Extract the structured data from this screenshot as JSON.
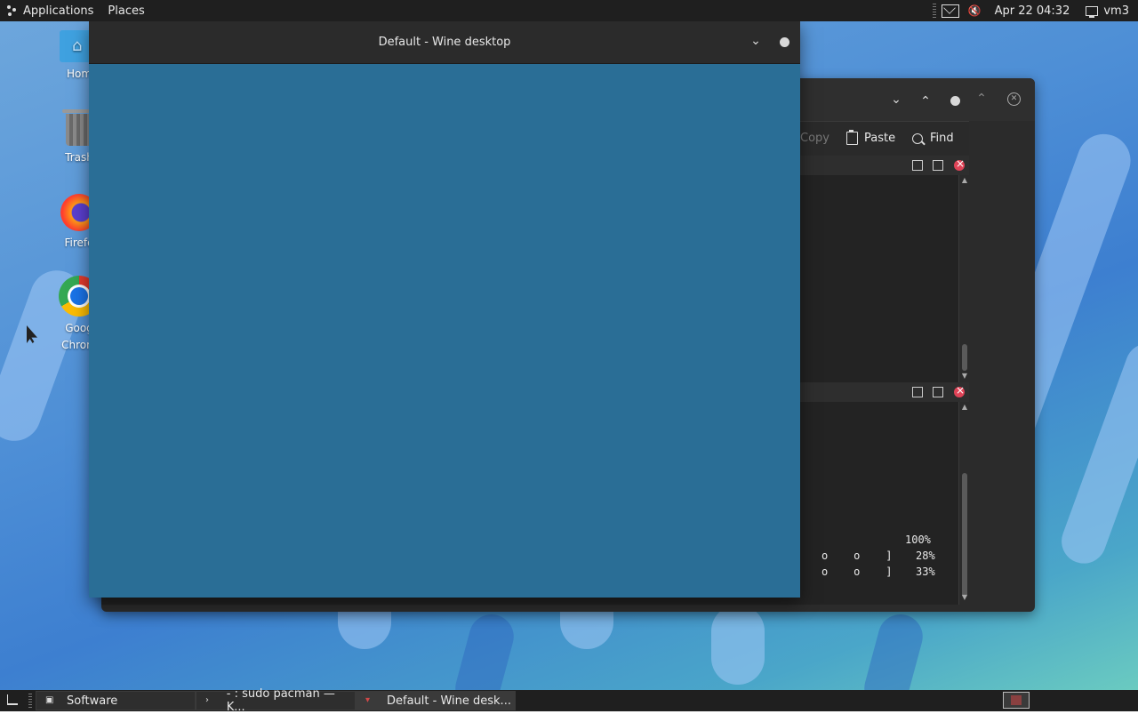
{
  "top_panel": {
    "applications_label": "Applications",
    "places_label": "Places",
    "clock": "Apr 22  04:32",
    "user": "vm3"
  },
  "desktop_icons": [
    {
      "label": "Home",
      "icon": "folder-home-icon"
    },
    {
      "label": "Trash",
      "icon": "trash-icon"
    },
    {
      "label": "Firefox",
      "icon": "firefox-icon"
    },
    {
      "label": "Google Chrome",
      "icon": "chrome-icon"
    }
  ],
  "desktop_labels_visible": [
    "Hom",
    "Trash",
    "Firefo",
    "Goog",
    "Chrom"
  ],
  "terminal_window": {
    "toolbar": {
      "copy_label": "Copy",
      "paste_label": "Paste",
      "find_label": "Find"
    },
    "bottom_lines": [
      {
        "cols": "",
        "pct": "100%"
      },
      {
        "cols": "o    o    ]",
        "pct": "28%"
      },
      {
        "cols": "o    o    ]",
        "pct": "33%"
      }
    ]
  },
  "wine_window": {
    "title": "Default - Wine desktop",
    "body_color": "#2a6e96"
  },
  "taskbar": {
    "tasks": [
      {
        "label": "Software",
        "icon": "software-icon"
      },
      {
        "label": "- : sudo pacman — K...",
        "icon": "terminal-icon"
      },
      {
        "label": "Default - Wine desk...",
        "icon": "wine-icon"
      }
    ]
  }
}
